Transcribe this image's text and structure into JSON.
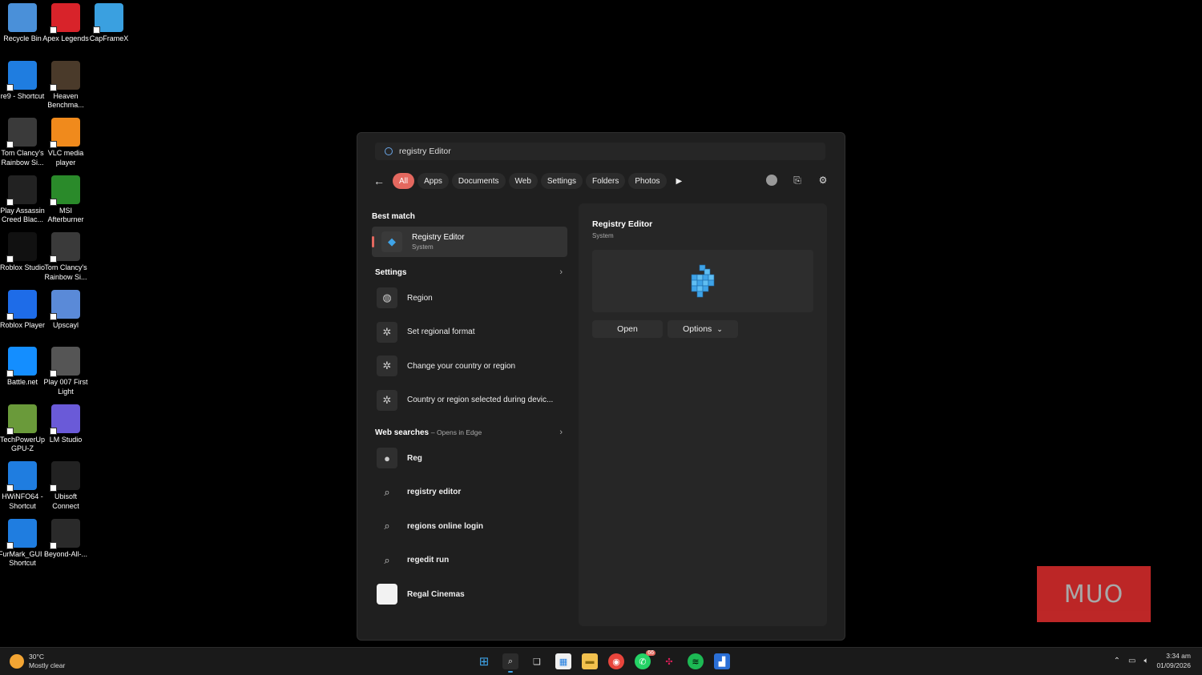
{
  "desktop_icons": [
    {
      "label": "Recycle Bin",
      "icon": "recycle-bin-icon",
      "color": "#4a90d9"
    },
    {
      "label": "Apex Legends",
      "icon": "apex-legends-icon",
      "color": "#d8232a"
    },
    {
      "label": "CapFrameX",
      "icon": "capframex-icon",
      "color": "#3aa0e0"
    },
    {
      "label": "re9 - Shortcut",
      "icon": "file-icon",
      "color": "#1f7de0"
    },
    {
      "label": "Heaven Benchma...",
      "icon": "heaven-benchmark-icon",
      "color": "#4a3a2a"
    },
    {
      "label": "Tom Clancy's Rainbow Si...",
      "icon": "rainbow-six-icon",
      "color": "#3a3a3a"
    },
    {
      "label": "VLC media player",
      "icon": "vlc-icon",
      "color": "#f08a1c"
    },
    {
      "label": "Play Assassin Creed Blac...",
      "icon": "assassins-creed-icon",
      "color": "#222222"
    },
    {
      "label": "MSI Afterburner",
      "icon": "msi-afterburner-icon",
      "color": "#2a8a2a"
    },
    {
      "label": "Roblox Studio",
      "icon": "roblox-studio-icon",
      "color": "#111111"
    },
    {
      "label": "Tom Clancy's Rainbow Si...",
      "icon": "rainbow-six-icon",
      "color": "#3a3a3a"
    },
    {
      "label": "Roblox Player",
      "icon": "roblox-player-icon",
      "color": "#1e6ce8"
    },
    {
      "label": "Upscayl",
      "icon": "upscayl-icon",
      "color": "#5a8ad8"
    },
    {
      "label": "Battle.net",
      "icon": "battle-net-icon",
      "color": "#148eff"
    },
    {
      "label": "Play 007 First Light",
      "icon": "007-first-light-icon",
      "color": "#555555"
    },
    {
      "label": "TechPowerUp GPU-Z",
      "icon": "gpu-z-icon",
      "color": "#6a9a3a"
    },
    {
      "label": "LM Studio",
      "icon": "lm-studio-icon",
      "color": "#6a5ad8"
    },
    {
      "label": "HWiNFO64 - Shortcut",
      "icon": "file-icon",
      "color": "#1f7de0"
    },
    {
      "label": "Ubisoft Connect",
      "icon": "ubisoft-icon",
      "color": "#222222"
    },
    {
      "label": "FurMark_GUI - Shortcut",
      "icon": "file-icon",
      "color": "#1f7de0"
    },
    {
      "label": "Beyond-All-...",
      "icon": "bar-icon",
      "color": "#2a2a2a"
    }
  ],
  "search": {
    "query": "registry Editor",
    "filters": [
      "All",
      "Apps",
      "Documents",
      "Web",
      "Settings",
      "Folders",
      "Photos"
    ],
    "active_filter": "All"
  },
  "results": {
    "best_match_title": "Best match",
    "best_match": {
      "name": "Registry Editor",
      "type": "System"
    },
    "settings_title": "Settings",
    "settings_items": [
      "Region",
      "Set regional format",
      "Change your country or region",
      "Country or region selected during devic..."
    ],
    "web_title": "Web searches",
    "web_subtitle": "– Opens in Edge",
    "web_items": [
      "Reg",
      "registry editor",
      "regions online login",
      "regedit run",
      "Regal Cinemas"
    ]
  },
  "preview": {
    "name": "Registry Editor",
    "type": "System",
    "open_label": "Open",
    "options_label": "Options"
  },
  "watermark": "MUO",
  "taskbar": {
    "temperature": "30°C",
    "weather": "Mostly clear",
    "time": "3:34 am",
    "date": "01/09/2026",
    "whatsapp_badge": "66",
    "apps": [
      "windows-start-icon",
      "search-icon",
      "task-view-icon",
      "microsoft-store-icon",
      "file-explorer-icon",
      "chrome-icon",
      "whatsapp-icon",
      "slack-icon",
      "spotify-icon",
      "app-icon"
    ]
  },
  "colors": {
    "accent": "#e4685f",
    "brand_blue": "#3fa4e8"
  }
}
